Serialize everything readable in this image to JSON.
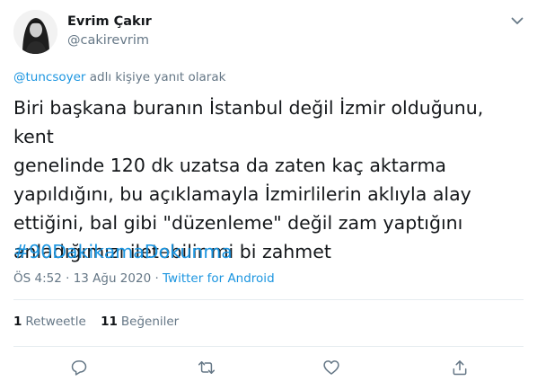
{
  "author": {
    "name": "Evrim Çakır",
    "handle": "@cakirevrim"
  },
  "reply": {
    "mention": "@tuncsoyer",
    "suffix": " adlı kişiye yanıt olarak"
  },
  "tweet": {
    "text": "Biri başkana buranın İstanbul değil İzmir olduğunu, kent\ngenelinde 120 dk uzatsa da zaten kaç aktarma\nyapıldığını, bu açıklamayla İzmirlilerin aklıyla alay\nettiğini, bal gibi \"düzenleme\" değil  zam yaptığını\nanladığımızı iletebilir mi bi zahmet",
    "hashtag": "#90DakikamaDokunma"
  },
  "meta": {
    "time": "ÖS 4:52",
    "separator": " · ",
    "date": "13 Ağu 2020",
    "source": "Twitter for Android"
  },
  "stats": {
    "retweets_count": "1",
    "retweets_label": "Retweetle",
    "likes_count": "11",
    "likes_label": "Beğeniler"
  },
  "actions": [
    "reply-icon",
    "retweet-icon",
    "like-icon",
    "share-icon"
  ],
  "colors": {
    "link": "#1b95e0",
    "secondary_text": "#657786",
    "primary_text": "#14171a",
    "divider": "#e6ecf0"
  }
}
